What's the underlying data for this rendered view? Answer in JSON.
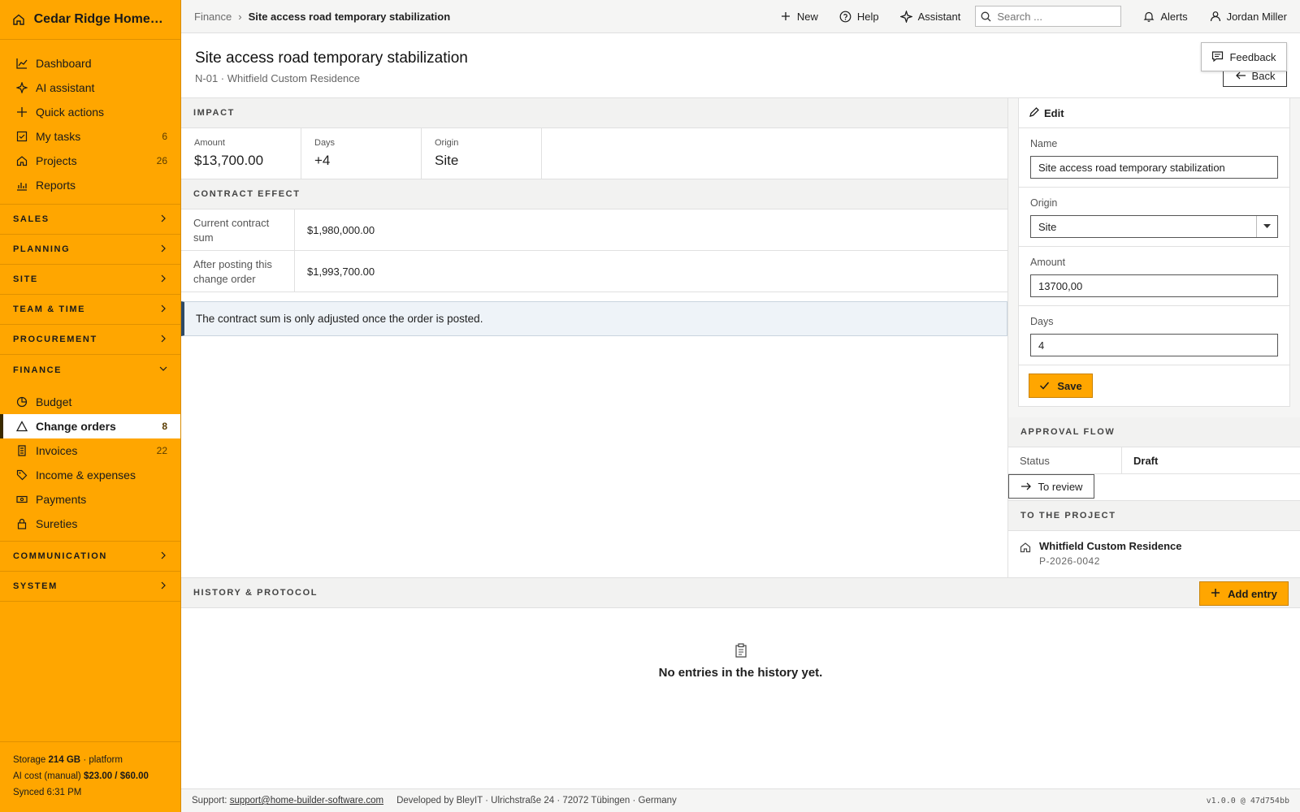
{
  "brand": {
    "name": "Cedar Ridge Homes L...",
    "icon": "home-icon",
    "accent": "#ffa600"
  },
  "sidebar": {
    "main": [
      {
        "label": "Dashboard",
        "icon": "chart-line-icon",
        "count": ""
      },
      {
        "label": "AI assistant",
        "icon": "sparkle-icon",
        "count": ""
      },
      {
        "label": "Quick actions",
        "icon": "plus-icon",
        "count": ""
      },
      {
        "label": "My tasks",
        "icon": "checkbox-icon",
        "count": "6"
      },
      {
        "label": "Projects",
        "icon": "home-icon",
        "count": "26"
      },
      {
        "label": "Reports",
        "icon": "bar-chart-icon",
        "count": ""
      }
    ],
    "groups": {
      "sales": "SALES",
      "planning": "PLANNING",
      "site": "SITE",
      "team": "TEAM & TIME",
      "procurement": "PROCUREMENT",
      "finance": "FINANCE",
      "communication": "COMMUNICATION",
      "system": "SYSTEM"
    },
    "finance_items": [
      {
        "label": "Budget",
        "icon": "pie-icon",
        "count": ""
      },
      {
        "label": "Change orders",
        "icon": "triangle-icon",
        "count": "8",
        "active": true
      },
      {
        "label": "Invoices",
        "icon": "receipt-icon",
        "count": "22"
      },
      {
        "label": "Income & expenses",
        "icon": "tag-icon",
        "count": ""
      },
      {
        "label": "Payments",
        "icon": "banknote-icon",
        "count": ""
      },
      {
        "label": "Sureties",
        "icon": "lock-icon",
        "count": ""
      }
    ],
    "footer": {
      "storage_label": "Storage",
      "storage_value": "214 GB",
      "storage_suffix": "· platform",
      "ai_label": "AI cost (manual)",
      "ai_value": "$23.00 / $60.00",
      "synced": "Synced 6:31 PM"
    }
  },
  "topbar": {
    "crumb_parent": "Finance",
    "crumb_current": "Site access road temporary stabilization",
    "new_label": "New",
    "help_label": "Help",
    "assistant_label": "Assistant",
    "search_placeholder": "Search ...",
    "alerts_label": "Alerts",
    "user_name": "Jordan Miller"
  },
  "page": {
    "title": "Site access road temporary stabilization",
    "subtitle": "N-01 · Whitfield Custom Residence",
    "back_label": "Back",
    "feedback_label": "Feedback"
  },
  "impact": {
    "heading": "IMPACT",
    "amount_label": "Amount",
    "amount_value": "$13,700.00",
    "days_label": "Days",
    "days_value": "+4",
    "origin_label": "Origin",
    "origin_value": "Site"
  },
  "contract_effect": {
    "heading": "CONTRACT EFFECT",
    "current_label": "Current contract sum",
    "current_value": "$1,980,000.00",
    "after_label": "After posting this change order",
    "after_value": "$1,993,700.00",
    "notice": "The contract sum is only adjusted once the order is posted."
  },
  "edit": {
    "heading": "Edit",
    "name_label": "Name",
    "name_value": "Site access road temporary stabilization",
    "origin_label": "Origin",
    "origin_value": "Site",
    "amount_label": "Amount",
    "amount_value": "13700,00",
    "days_label": "Days",
    "days_value": "4",
    "save_label": "Save"
  },
  "approval": {
    "heading": "APPROVAL FLOW",
    "status_label": "Status",
    "status_value": "Draft",
    "review_label": "To review"
  },
  "project": {
    "heading": "TO THE PROJECT",
    "name": "Whitfield Custom Residence",
    "code": "P-2026-0042"
  },
  "history": {
    "heading": "HISTORY & PROTOCOL",
    "add_label": "Add entry",
    "empty_text": "No entries in the history yet."
  },
  "footer": {
    "support_label": "Support:",
    "support_email": "support@home-builder-software.com",
    "developer": "Developed by BleyIT · Ulrichstraße 24 · 72072 Tübingen · Germany",
    "version": "v1.0.0 @ 47d754bb"
  }
}
